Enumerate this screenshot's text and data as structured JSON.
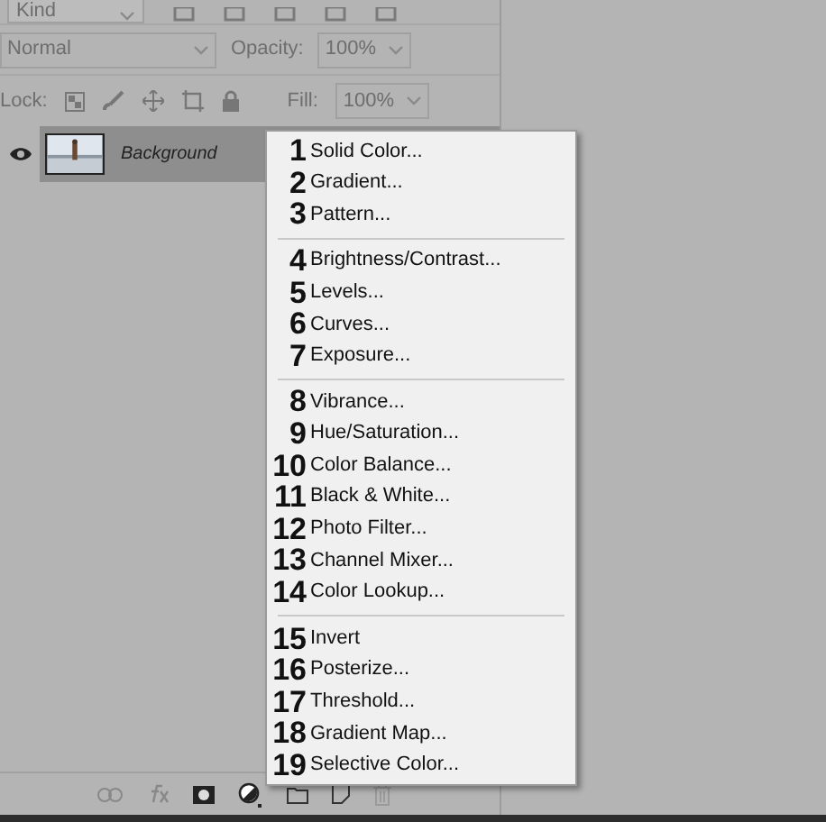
{
  "filter": {
    "value": "Kind"
  },
  "blend_mode": {
    "value": "Normal"
  },
  "opacity": {
    "label": "Opacity:",
    "value": "100%"
  },
  "lock": {
    "label": "Lock:"
  },
  "fill": {
    "label": "Fill:",
    "value": "100%"
  },
  "layers": [
    {
      "name": "Background",
      "visible": true,
      "selected": true
    }
  ],
  "menu": {
    "groups": [
      [
        {
          "number": "1",
          "label": "Solid Color..."
        },
        {
          "number": "2",
          "label": "Gradient..."
        },
        {
          "number": "3",
          "label": "Pattern..."
        }
      ],
      [
        {
          "number": "4",
          "label": "Brightness/Contrast..."
        },
        {
          "number": "5",
          "label": "Levels..."
        },
        {
          "number": "6",
          "label": "Curves..."
        },
        {
          "number": "7",
          "label": "Exposure..."
        }
      ],
      [
        {
          "number": "8",
          "label": "Vibrance..."
        },
        {
          "number": "9",
          "label": "Hue/Saturation..."
        },
        {
          "number": "10",
          "label": "Color Balance..."
        },
        {
          "number": "11",
          "label": "Black & White..."
        },
        {
          "number": "12",
          "label": "Photo Filter..."
        },
        {
          "number": "13",
          "label": "Channel Mixer..."
        },
        {
          "number": "14",
          "label": "Color Lookup..."
        }
      ],
      [
        {
          "number": "15",
          "label": "Invert"
        },
        {
          "number": "16",
          "label": "Posterize..."
        },
        {
          "number": "17",
          "label": "Threshold..."
        },
        {
          "number": "18",
          "label": "Gradient Map..."
        },
        {
          "number": "19",
          "label": "Selective Color..."
        }
      ]
    ]
  }
}
